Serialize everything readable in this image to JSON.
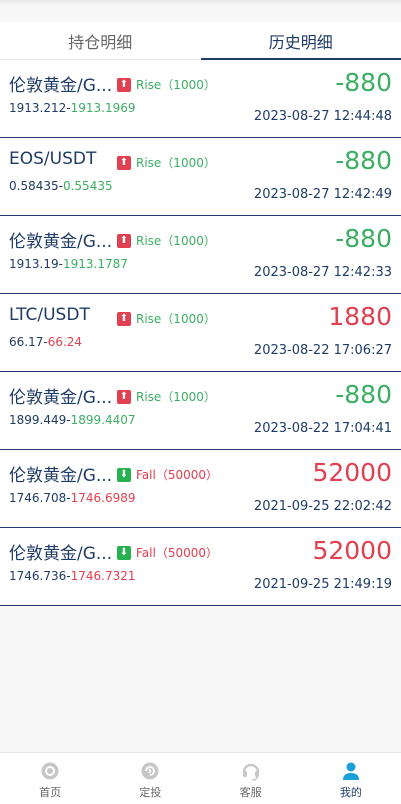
{
  "tabs": [
    {
      "label": "持仓明细",
      "active": false
    },
    {
      "label": "历史明细",
      "active": true
    }
  ],
  "rows": [
    {
      "symbol": "伦敦黄金/G...",
      "direction": "up",
      "badge": "Rise（1000）",
      "open": "1913.212",
      "close": "1913.1969",
      "close_color": "green",
      "pnl": "-880",
      "pnl_color": "green",
      "time": "2023-08-27 12:44:48"
    },
    {
      "symbol": "EOS/USDT",
      "direction": "up",
      "badge": "Rise（1000）",
      "open": "0.58435",
      "close": "0.55435",
      "close_color": "green",
      "pnl": "-880",
      "pnl_color": "green",
      "time": "2023-08-27 12:42:49"
    },
    {
      "symbol": "伦敦黄金/G...",
      "direction": "up",
      "badge": "Rise（1000）",
      "open": "1913.19",
      "close": "1913.1787",
      "close_color": "green",
      "pnl": "-880",
      "pnl_color": "green",
      "time": "2023-08-27 12:42:33"
    },
    {
      "symbol": "LTC/USDT",
      "direction": "up",
      "badge": "Rise（1000）",
      "open": "66.17",
      "close": "66.24",
      "close_color": "red",
      "pnl": "1880",
      "pnl_color": "red",
      "time": "2023-08-22 17:06:27"
    },
    {
      "symbol": "伦敦黄金/G...",
      "direction": "up",
      "badge": "Rise（1000）",
      "open": "1899.449",
      "close": "1899.4407",
      "close_color": "green",
      "pnl": "-880",
      "pnl_color": "green",
      "time": "2023-08-22 17:04:41"
    },
    {
      "symbol": "伦敦黄金/G...",
      "direction": "down",
      "badge": "Fall（50000）",
      "open": "1746.708",
      "close": "1746.6989",
      "close_color": "red",
      "pnl": "52000",
      "pnl_color": "red",
      "time": "2021-09-25 22:02:42"
    },
    {
      "symbol": "伦敦黄金/G...",
      "direction": "down",
      "badge": "Fall（50000）",
      "open": "1746.736",
      "close": "1746.7321",
      "close_color": "red",
      "pnl": "52000",
      "pnl_color": "red",
      "time": "2021-09-25 21:49:19"
    }
  ],
  "nav": [
    {
      "label": "首页",
      "icon": "home-icon",
      "active": false
    },
    {
      "label": "定投",
      "icon": "invest-icon",
      "active": false
    },
    {
      "label": "客服",
      "icon": "headset-icon",
      "active": false
    },
    {
      "label": "我的",
      "icon": "user-icon",
      "active": true
    }
  ],
  "colors": {
    "navy": "#1f3b66",
    "green": "#3cae63",
    "red": "#e0404f",
    "nav_active": "#1aa0d8",
    "nav_inactive": "#bdbdbd"
  }
}
